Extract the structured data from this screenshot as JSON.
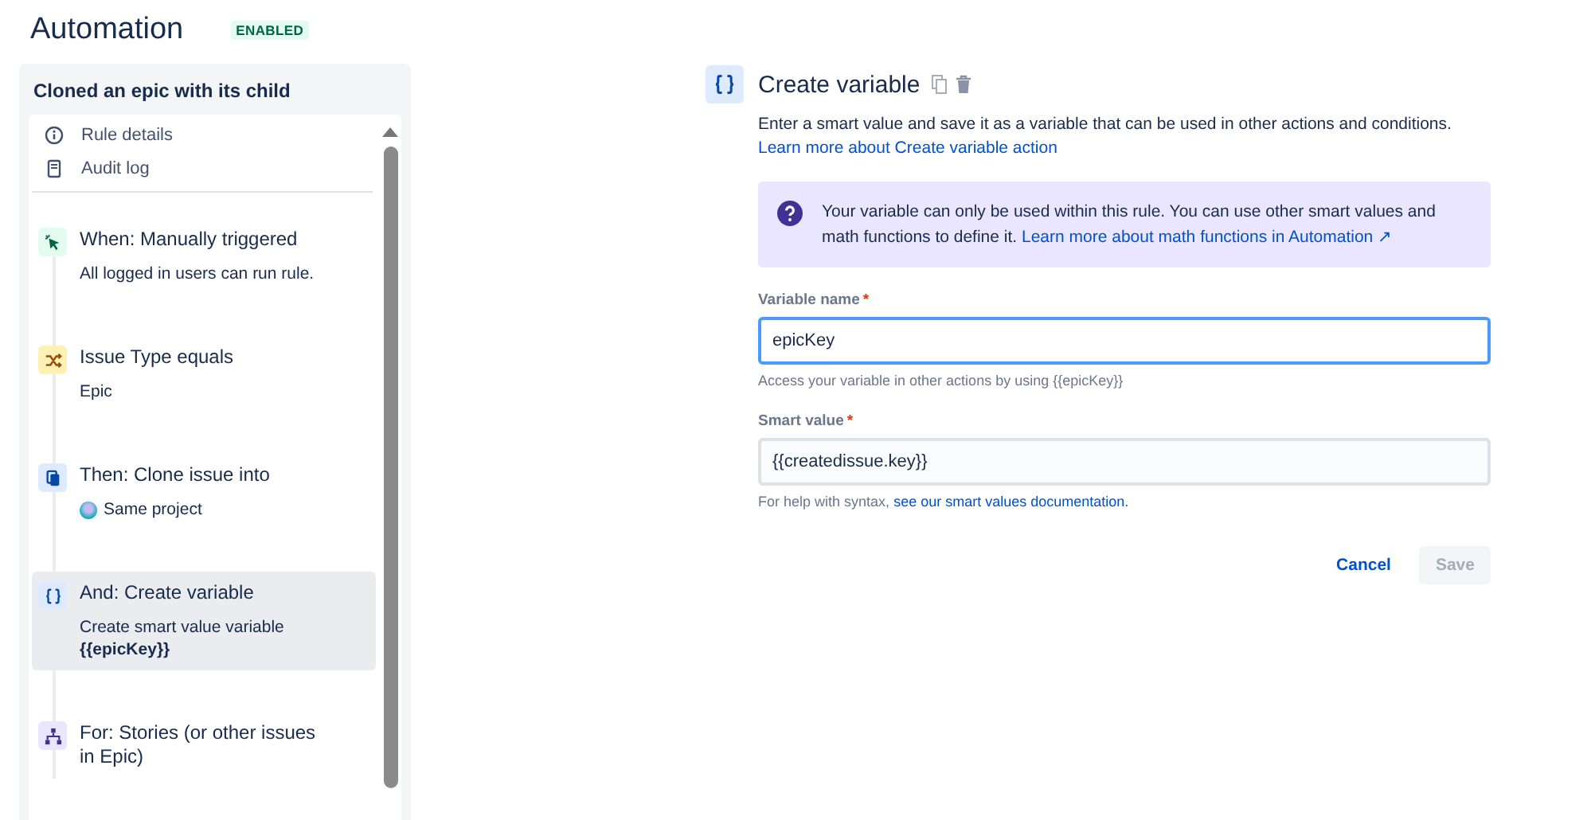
{
  "header": {
    "title": "Automation",
    "status_badge": "ENABLED"
  },
  "rule": {
    "name": "Cloned an epic with its child",
    "links": [
      {
        "kind": "info",
        "label": "Rule details"
      },
      {
        "kind": "log",
        "label": "Audit log"
      }
    ],
    "steps": [
      {
        "kind": "trigger",
        "title": "When: Manually triggered",
        "detail": "All logged in users can run rule.",
        "selected": false
      },
      {
        "kind": "condition",
        "title": "Issue Type equals",
        "detail": "Epic",
        "selected": false
      },
      {
        "kind": "action",
        "title": "Then: Clone issue into",
        "detail": "Same project",
        "project_avatar": true,
        "selected": false
      },
      {
        "kind": "variable",
        "title": "And: Create variable",
        "detail": "Create smart value variable **{{epicKey}}**",
        "selected": true
      },
      {
        "kind": "branch",
        "title": "For: Stories (or other issues in Epic)",
        "selected": false
      }
    ]
  },
  "editor": {
    "title": "Create variable",
    "description": "Enter a smart value and save it as a variable that can be used in other actions and conditions.",
    "description_link": "Learn more about Create variable action",
    "info": "Your variable can only be used within this rule. You can use other smart values and math functions to define it.",
    "info_link": "Learn more about math functions in Automation ↗",
    "fields": [
      {
        "label": "Variable name",
        "required_mark": "*",
        "value": "epicKey",
        "focused": true,
        "help": "Access your variable in other actions by using {{epicKey}}"
      },
      {
        "label": "Smart value",
        "required_mark": "*",
        "value": "{{createdissue.key}}",
        "focused": false,
        "help": "For help with syntax,",
        "help_link": "see our smart values documentation."
      }
    ],
    "buttons": [
      {
        "kind": "link",
        "label": "Cancel",
        "disabled": false
      },
      {
        "kind": "primary",
        "label": "Save",
        "disabled": true
      }
    ]
  }
}
